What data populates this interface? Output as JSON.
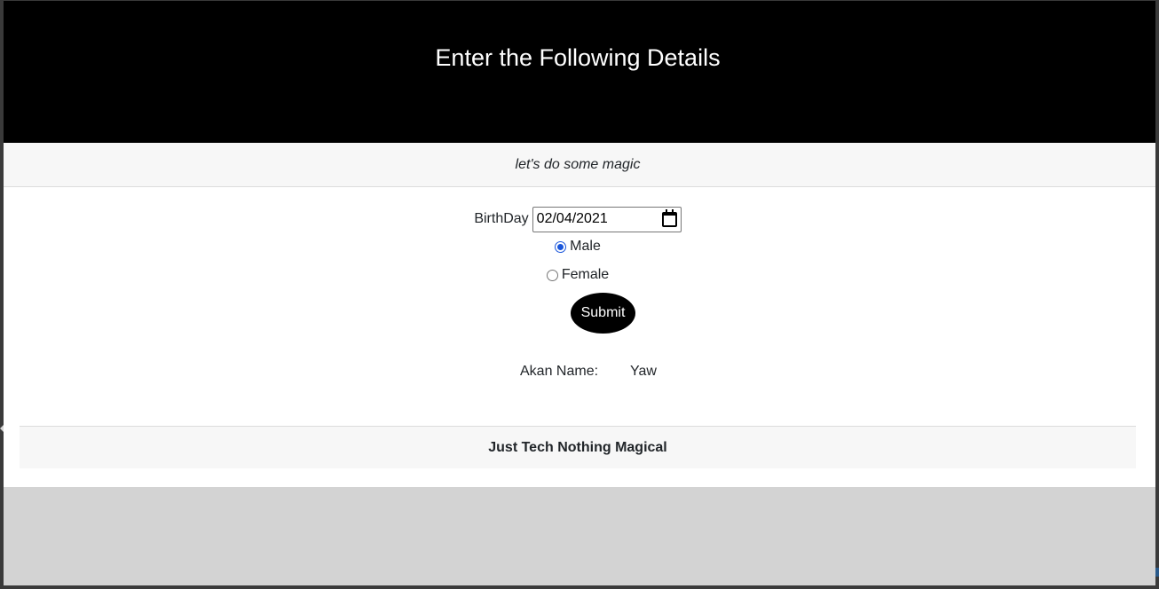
{
  "header": {
    "title": "Enter the Following Details"
  },
  "subheader": {
    "tagline": "let's do some magic"
  },
  "form": {
    "birthday_label": "BirthDay",
    "birthday_value": "02/04/2021",
    "gender_options": [
      {
        "label": "Male",
        "checked": true
      },
      {
        "label": "Female",
        "checked": false
      }
    ],
    "submit_label": "Submit"
  },
  "result": {
    "label": "Akan Name:",
    "value": "Yaw"
  },
  "footer": {
    "text": "Just Tech Nothing Magical"
  },
  "colors": {
    "header_bg": "#000000",
    "radio_accent": "#1a56db",
    "button_bg": "#000000",
    "outer_bg": "#d3d3d3"
  },
  "icons": {
    "date_picker": "calendar-icon"
  }
}
